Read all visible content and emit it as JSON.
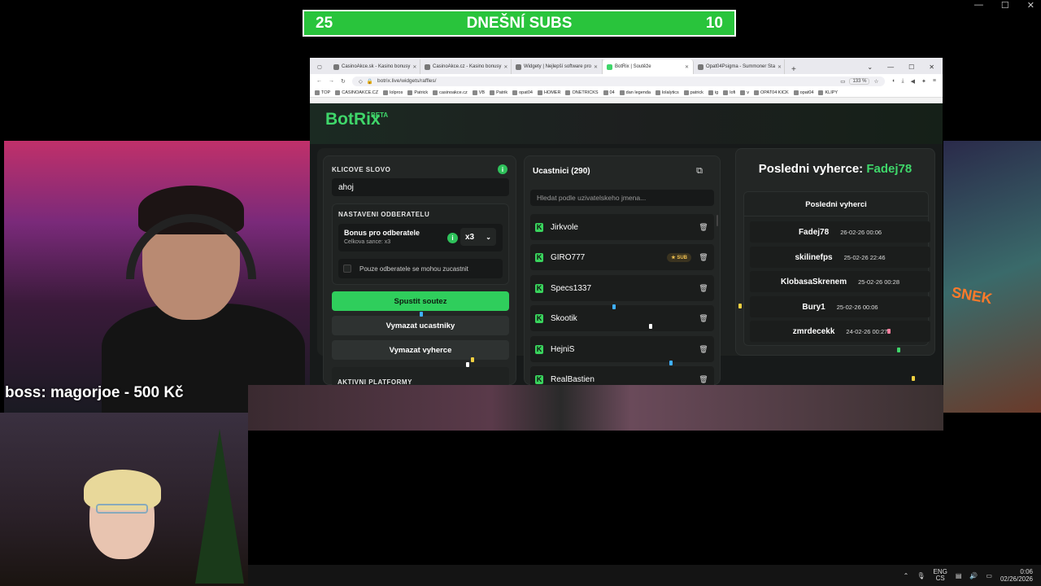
{
  "subs_bar": {
    "left": "25",
    "title": "DNEŠNÍ SUBS",
    "right": "10"
  },
  "window_controls": {
    "minimize": "—",
    "maximize": "☐",
    "close": "✕"
  },
  "overlay": {
    "boss_message": "boss:  magorjoe - 500 Kč"
  },
  "browser": {
    "tabs": [
      {
        "label": "CasinoAkce.sk - Kasino bonusy"
      },
      {
        "label": "CasinoAkce.cz - Kasino bonusy"
      },
      {
        "label": "Widgety | Nejlepší software pro"
      },
      {
        "label": "BotRix | Soutěže",
        "active": true
      },
      {
        "label": "Opat04Psigma - Summoner Sta"
      }
    ],
    "url": "botrix.live/widgets/raffles/",
    "zoom": "133 %",
    "bookmarks": [
      "TOP",
      "CASINOAKCE.CZ",
      "lolpros",
      "Patrick",
      "casinoakce.cz",
      "VB",
      "Patrik",
      "opat04",
      "HOMER",
      "ONETRICKS",
      "04",
      "dan legenda",
      "lolalytics",
      "patrick",
      "ig",
      "lofi",
      "v",
      "OPAT04 KICK",
      "opat04",
      "KLIPY"
    ]
  },
  "app": {
    "logo": "BotRix",
    "logo_badge": "BETA",
    "left_panel": {
      "keyword_label": "KLICOVE SLOVO",
      "keyword_value": "ahoj",
      "subscriber_settings_label": "NASTAVENI ODBERATELU",
      "bonus_title": "Bonus pro odberatele",
      "bonus_subtitle": "Celkova sance: x3",
      "bonus_multiplier": "x3",
      "only_subs_label": "Pouze odberatele se mohou zucastnit",
      "start_button": "Spustit soutez",
      "clear_participants_button": "Vymazat ucastniky",
      "clear_winners_button": "Vymazat vyherce",
      "platforms_label": "AKTIVNI PLATFORMY"
    },
    "middle_panel": {
      "title": "Ucastnici (290)",
      "search_placeholder": "Hledat podle uzivatelskeho jmena...",
      "participants": [
        {
          "name": "Jirkvole",
          "badge": ""
        },
        {
          "name": "GIRO777",
          "badge": "SUB"
        },
        {
          "name": "Specs1337",
          "badge": ""
        },
        {
          "name": "Skootik",
          "badge": ""
        },
        {
          "name": "HejniS",
          "badge": ""
        },
        {
          "name": "RealBastien",
          "badge": ""
        }
      ]
    },
    "right_panel": {
      "last_winner_label": "Posledni vyherce:",
      "last_winner_name": "Fadej78",
      "winners_header": "Posledni vyherci",
      "winners": [
        {
          "name": "Fadej78",
          "date": "26-02-26 00:06"
        },
        {
          "name": "skilinefps",
          "date": "25-02-26 22:46"
        },
        {
          "name": "KlobasaSkrenem",
          "date": "25-02-26 00:28"
        },
        {
          "name": "Bury1",
          "date": "25-02-26 00:06"
        },
        {
          "name": "zmrdecekk",
          "date": "24-02-26 00:27"
        }
      ]
    }
  },
  "game_overlay_text": "SNEK",
  "taskbar": {
    "lang_top": "ENG",
    "lang_bottom": "CS",
    "time": "0:06",
    "date": "02/26/2026"
  },
  "colors": {
    "accent_green": "#3fd66a",
    "subs_bar_green": "#29c43c",
    "sub_badge": "#f0c050"
  }
}
